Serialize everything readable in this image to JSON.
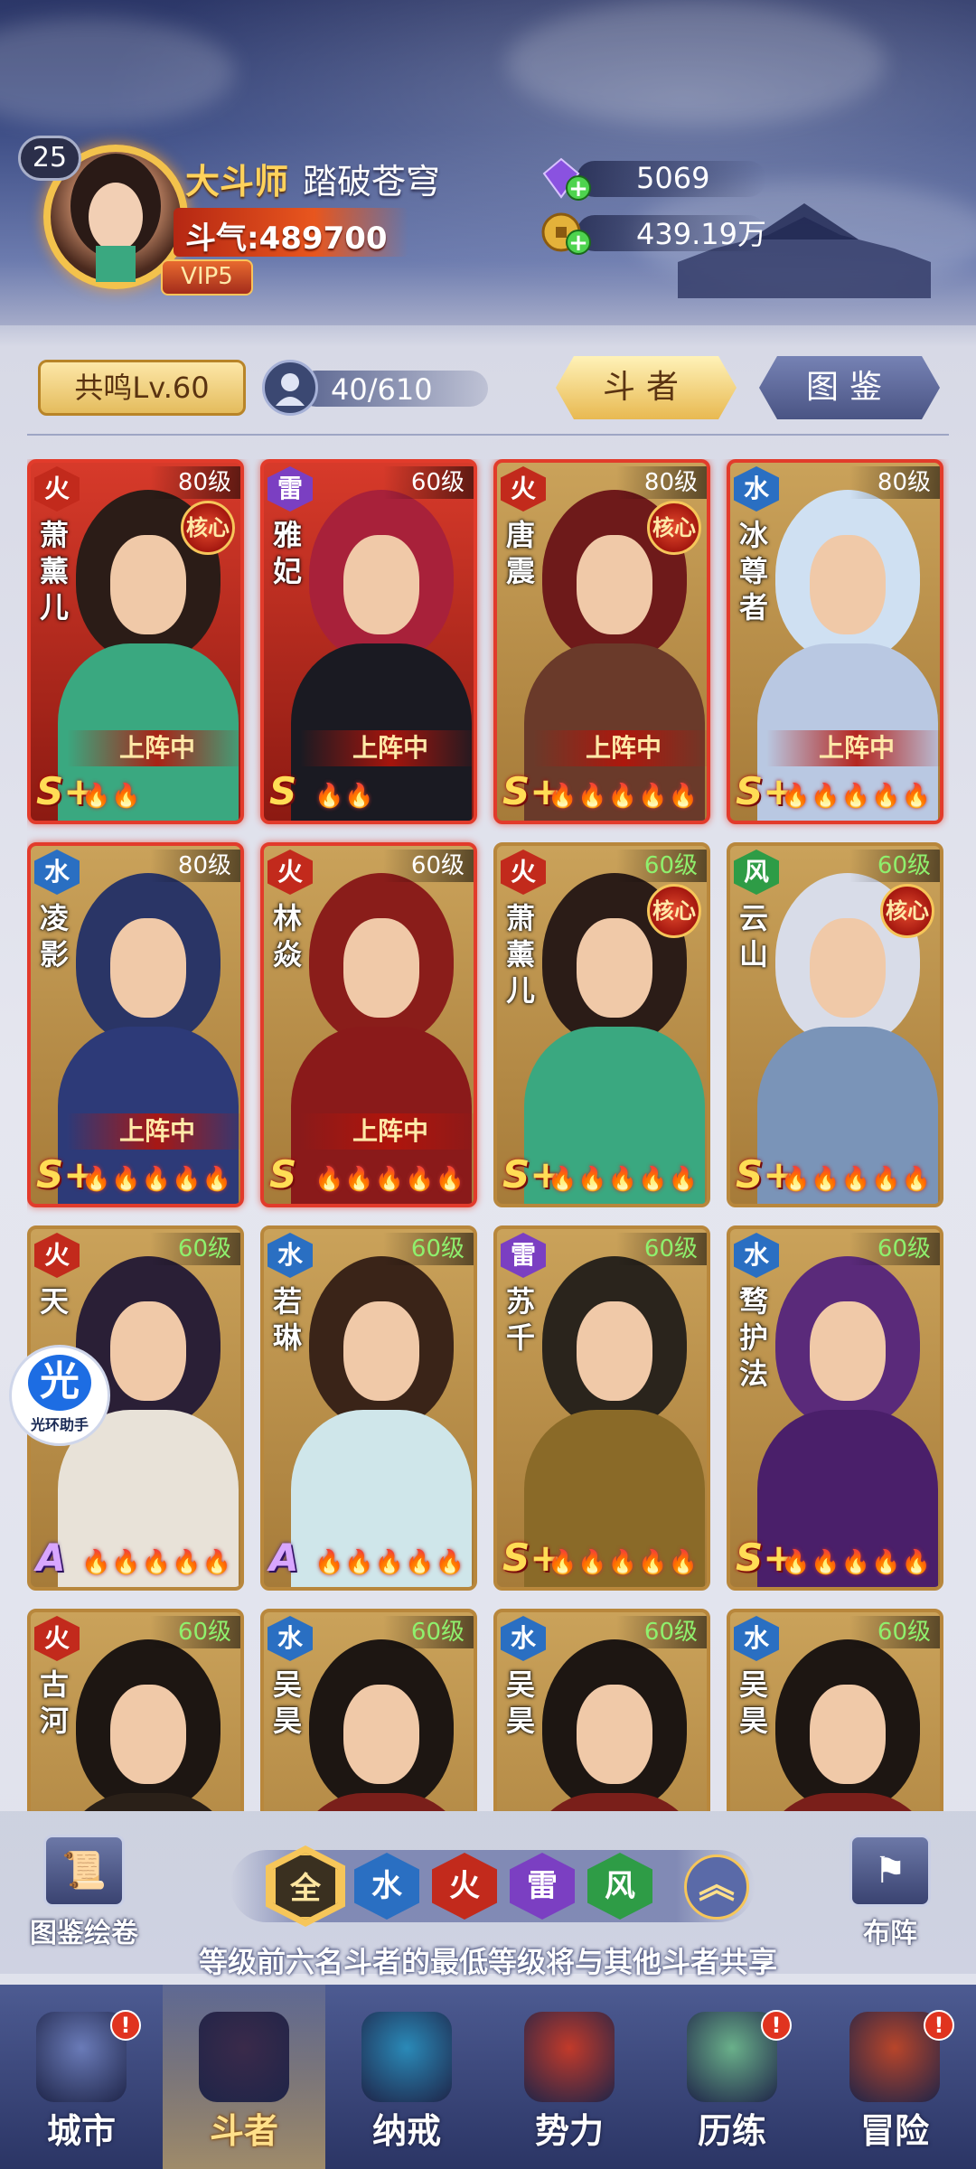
{
  "player": {
    "level": "25",
    "rank": "大斗师",
    "name": "踏破苍穹",
    "douqi_label": "斗气:489700",
    "vip": "VIP5"
  },
  "currency": {
    "gems": "5069",
    "gold": "439.19万"
  },
  "toolbar": {
    "resonance": "共鸣Lv.60",
    "hero_count": "40/610",
    "tab_heroes": "斗者",
    "tab_album": "图鉴"
  },
  "heroes": [
    {
      "element": "火",
      "element_type": "fire",
      "level": "80级",
      "level_color": "white",
      "name": "萧薰儿",
      "core": "核心",
      "deployed": "上阵中",
      "rarity": "S+",
      "stars": "🔥🔥",
      "bg": "red"
    },
    {
      "element": "雷",
      "element_type": "thunder",
      "level": "60级",
      "level_color": "white",
      "name": "雅妃",
      "core": "",
      "deployed": "上阵中",
      "rarity": "S",
      "stars": "🔥🔥",
      "bg": "red"
    },
    {
      "element": "火",
      "element_type": "fire",
      "level": "80级",
      "level_color": "white",
      "name": "唐震",
      "core": "核心",
      "deployed": "上阵中",
      "rarity": "S+",
      "stars": "🔥🔥🔥🔥🔥",
      "bg": "gold"
    },
    {
      "element": "水",
      "element_type": "water",
      "level": "80级",
      "level_color": "white",
      "name": "冰尊者",
      "core": "",
      "deployed": "上阵中",
      "rarity": "S+",
      "stars": "🔥🔥🔥🔥🔥",
      "bg": "gold"
    },
    {
      "element": "水",
      "element_type": "water",
      "level": "80级",
      "level_color": "white",
      "name": "凌影",
      "core": "",
      "deployed": "上阵中",
      "rarity": "S+",
      "stars": "🔥🔥🔥🔥🔥",
      "bg": "gold"
    },
    {
      "element": "火",
      "element_type": "fire",
      "level": "60级",
      "level_color": "white",
      "name": "林焱",
      "core": "",
      "deployed": "上阵中",
      "rarity": "S",
      "stars": "🔥🔥🔥🔥🔥",
      "bg": "gold"
    },
    {
      "element": "火",
      "element_type": "fire",
      "level": "60级",
      "level_color": "green",
      "name": "萧薰儿",
      "core": "核心",
      "deployed": "",
      "rarity": "S+",
      "stars": "🔥🔥🔥🔥🔥",
      "bg": "gold"
    },
    {
      "element": "风",
      "element_type": "wind",
      "level": "60级",
      "level_color": "green",
      "name": "云山",
      "core": "核心",
      "deployed": "",
      "rarity": "S+",
      "stars": "🔥🔥🔥🔥🔥",
      "bg": "gold"
    },
    {
      "element": "火",
      "element_type": "fire",
      "level": "60级",
      "level_color": "green",
      "name": "天",
      "core": "",
      "deployed": "",
      "rarity": "A",
      "stars": "🔥🔥🔥🔥🔥",
      "bg": "gold"
    },
    {
      "element": "水",
      "element_type": "water",
      "level": "60级",
      "level_color": "green",
      "name": "若琳",
      "core": "",
      "deployed": "",
      "rarity": "A",
      "stars": "🔥🔥🔥🔥🔥",
      "bg": "gold"
    },
    {
      "element": "雷",
      "element_type": "thunder",
      "level": "60级",
      "level_color": "green",
      "name": "苏千",
      "core": "",
      "deployed": "",
      "rarity": "S+",
      "stars": "🔥🔥🔥🔥🔥",
      "bg": "gold"
    },
    {
      "element": "水",
      "element_type": "water",
      "level": "60级",
      "level_color": "green",
      "name": "骛护法",
      "core": "",
      "deployed": "",
      "rarity": "S+",
      "stars": "🔥🔥🔥🔥🔥",
      "bg": "gold"
    },
    {
      "element": "火",
      "element_type": "fire",
      "level": "60级",
      "level_color": "green",
      "name": "古河",
      "core": "",
      "deployed": "",
      "rarity": "",
      "stars": "",
      "bg": "gold"
    },
    {
      "element": "水",
      "element_type": "water",
      "level": "60级",
      "level_color": "green",
      "name": "吴昊",
      "core": "",
      "deployed": "",
      "rarity": "",
      "stars": "",
      "bg": "gold"
    },
    {
      "element": "水",
      "element_type": "water",
      "level": "60级",
      "level_color": "green",
      "name": "吴昊",
      "core": "",
      "deployed": "",
      "rarity": "",
      "stars": "",
      "bg": "gold"
    },
    {
      "element": "水",
      "element_type": "water",
      "level": "60级",
      "level_color": "green",
      "name": "吴昊",
      "core": "",
      "deployed": "",
      "rarity": "",
      "stars": "",
      "bg": "gold"
    }
  ],
  "controls": {
    "album_scroll": "图鉴绘卷",
    "formation": "布阵",
    "filter_all": "全",
    "filter_water": "水",
    "filter_fire": "火",
    "filter_thunder": "雷",
    "filter_wind": "风",
    "collapse": "︽",
    "hint": "等级前六名斗者的最低等级将与其他斗者共享"
  },
  "helper": {
    "icon_char": "光",
    "label": "光环助手"
  },
  "nav": [
    {
      "label": "城市",
      "badge": "!",
      "active": false
    },
    {
      "label": "斗者",
      "badge": "",
      "active": true
    },
    {
      "label": "纳戒",
      "badge": "",
      "active": false
    },
    {
      "label": "势力",
      "badge": "",
      "active": false
    },
    {
      "label": "历练",
      "badge": "!",
      "active": false
    },
    {
      "label": "冒险",
      "badge": "!",
      "active": false
    }
  ],
  "colors": {
    "fire": "#c22a1c",
    "water": "#2a6fc2",
    "thunder": "#7b3fc2",
    "wind": "#2e9c46",
    "gold_accent": "#f6c65a"
  }
}
